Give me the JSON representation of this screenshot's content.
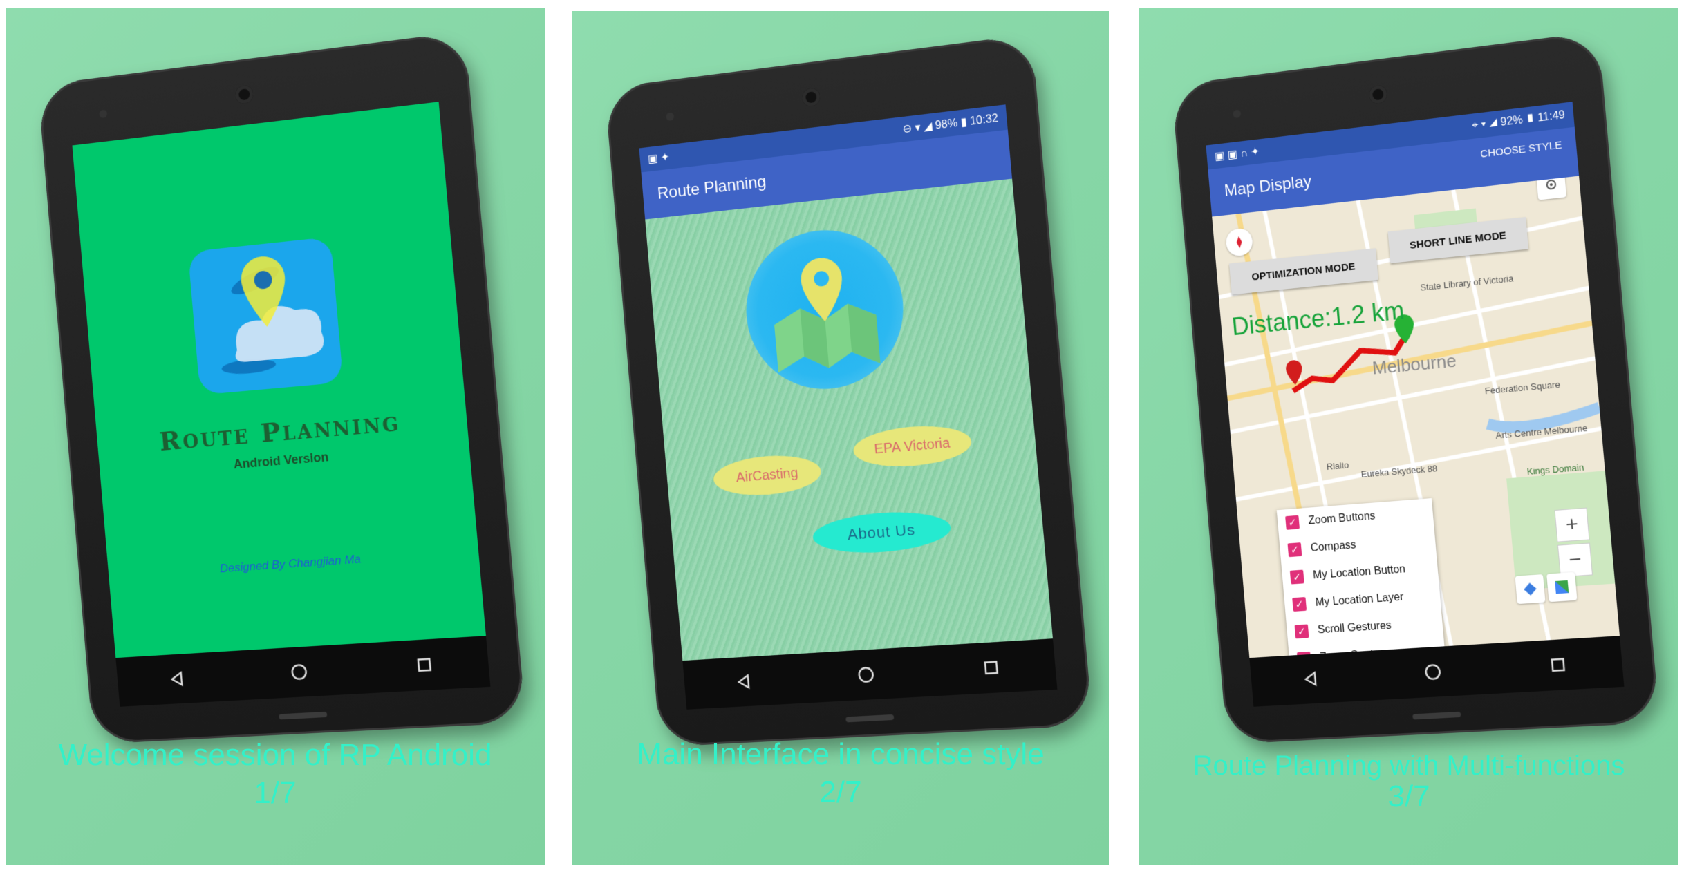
{
  "panels": [
    {
      "screen": {
        "brand_title": "Route Planning",
        "brand_subtitle": "Android Version",
        "designed_by": "Designed By Changjian Ma"
      },
      "caption_line1": "Welcome session of RP Android",
      "caption_line2": "1/7"
    },
    {
      "screen": {
        "status_time": "10:32",
        "status_battery": "98%",
        "appbar_title": "Route Planning",
        "button_aircasting": "AirCasting",
        "button_epa": "EPA Victoria",
        "button_about": "About Us"
      },
      "caption_line1": "Main Interface in concise style",
      "caption_line2": "2/7"
    },
    {
      "screen": {
        "status_time": "11:49",
        "status_battery": "92%",
        "appbar_title": "Map Display",
        "appbar_action": "CHOOSE STYLE",
        "optimization_mode": "OPTIMIZATION MODE",
        "short_line_mode": "SHORT LINE MODE",
        "distance": "Distance:1.2 km",
        "map_city": "Melbourne",
        "map_labels": [
          "State Library of Victoria",
          "Federation Square",
          "Arts Centre Melbourne",
          "Kings Domain",
          "Eureka Skydeck 88",
          "Rialto"
        ],
        "menu_items": [
          "Zoom Buttons",
          "Compass",
          "My Location Button",
          "My Location Layer",
          "Scroll Gestures",
          "Zoom Gestures"
        ]
      },
      "caption_line1": "Route Planning with Multi-functions",
      "caption_line2": "3/7"
    }
  ],
  "colors": {
    "background": "#86d6a6",
    "caption": "#34f0c8",
    "splash": "#00c86c",
    "appbar": "#3f63c6",
    "route": "#e01010"
  }
}
